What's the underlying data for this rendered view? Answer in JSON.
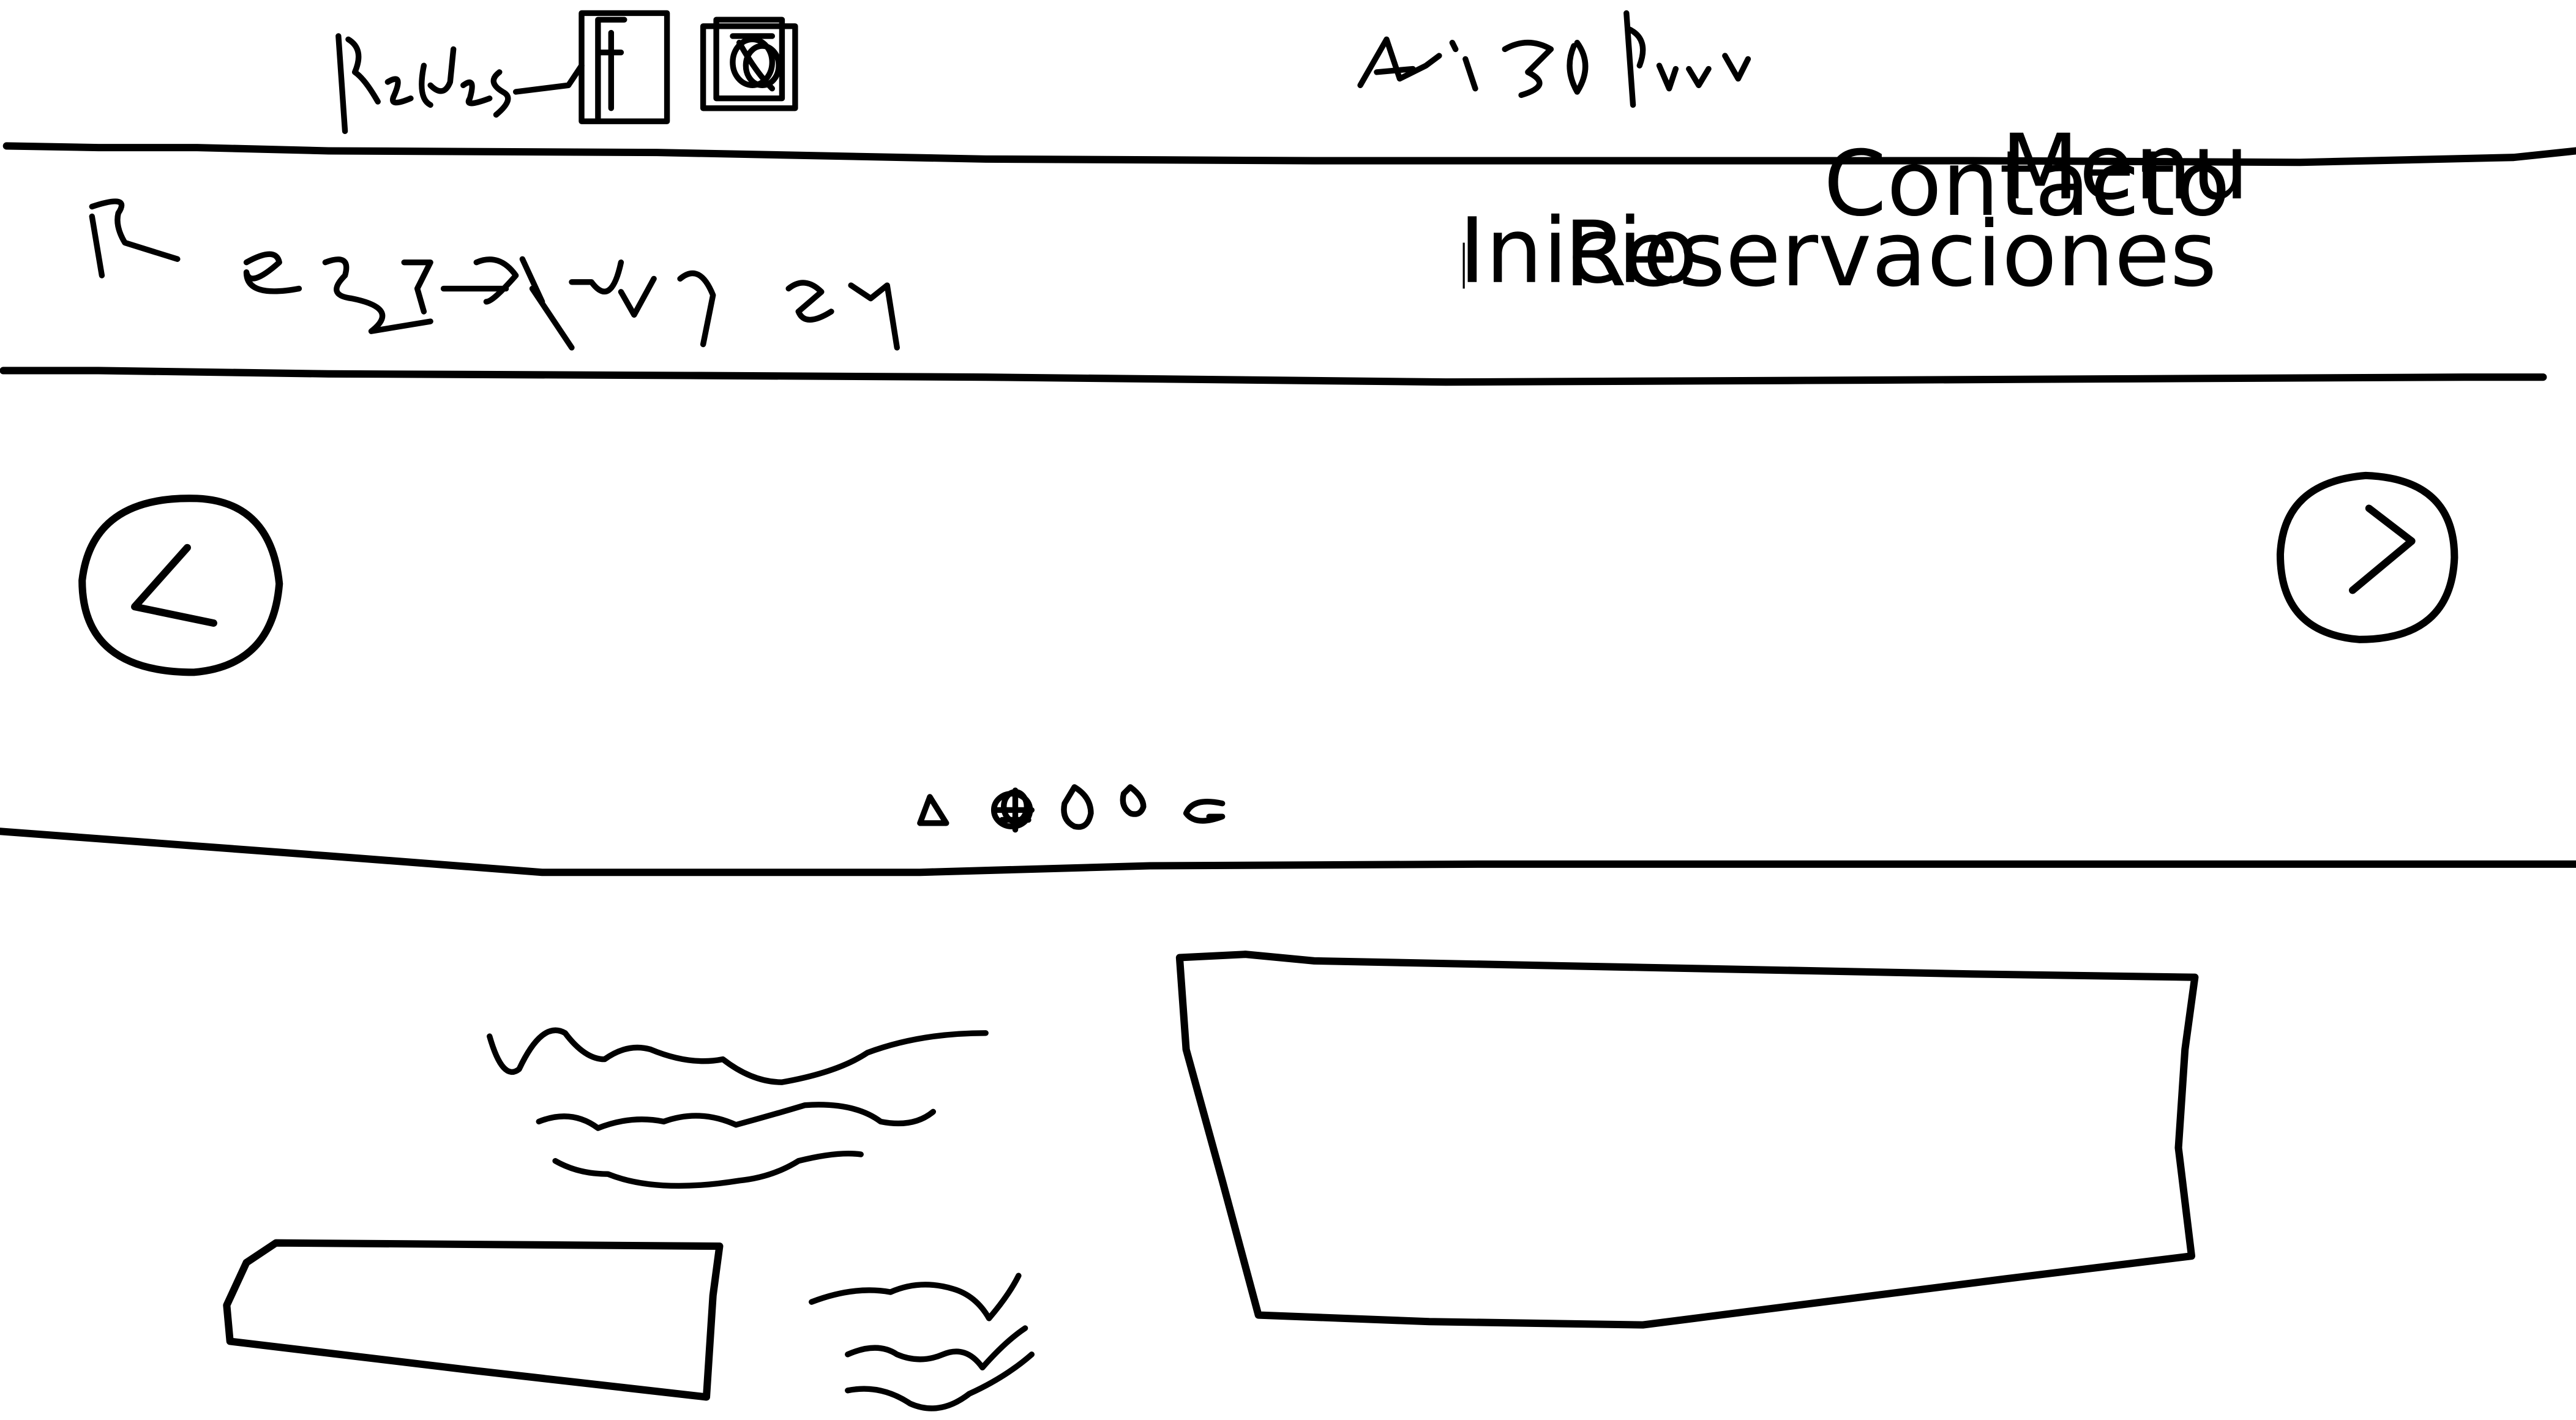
{
  "nav": {
    "items": [
      {
        "id": "inicio",
        "label": "Inicio"
      },
      {
        "id": "reservaciones",
        "label": "Reservaciones"
      },
      {
        "id": "contacto",
        "label": "Contacto"
      },
      {
        "id": "menu",
        "label": "Menu"
      }
    ]
  },
  "carousel": {
    "dot_count": 5
  },
  "colors": {
    "stroke": "#000000",
    "background": "#ffffff"
  },
  "icons": {
    "prev": "chevron-left-icon",
    "next": "chevron-right-icon",
    "social_f": "facebook-icon",
    "social_camera": "instagram-icon"
  }
}
